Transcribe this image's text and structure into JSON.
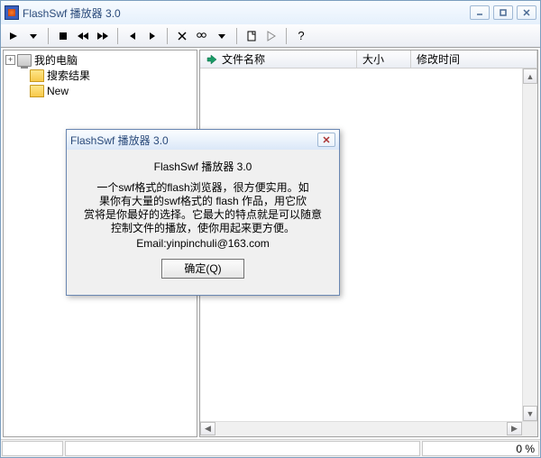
{
  "window": {
    "title": "FlashSwf 播放器 3.0"
  },
  "toolbar_icons": {
    "play": "play",
    "stop": "stop",
    "rew": "rewind",
    "ff": "fast-forward",
    "sep": "",
    "prev": "prev-frame",
    "next": "next-frame",
    "scissors": "cut",
    "binoc": "find",
    "new": "new-doc",
    "arrow": "run",
    "help": "?"
  },
  "tree": {
    "items": [
      {
        "label": "我的电脑",
        "icon": "computer",
        "depth": 0,
        "toggle": "+"
      },
      {
        "label": "搜索结果",
        "icon": "folder",
        "depth": 1,
        "toggle": ""
      },
      {
        "label": "New",
        "icon": "folder",
        "depth": 1,
        "toggle": ""
      }
    ]
  },
  "list": {
    "columns": {
      "name": "文件名称",
      "size": "大小",
      "date": "修改时间"
    }
  },
  "status": {
    "percent": "0 %"
  },
  "about": {
    "title": "FlashSwf 播放器 3.0",
    "heading": "FlashSwf 播放器 3.0",
    "body_lines": [
      "一个swf格式的flash浏览器，很方便实用。如",
      "果你有大量的swf格式的    flash 作品，用它欣",
      "赏将是你最好的选择。它最大的特点就是可以随意",
      "控制文件的播放，使你用起来更方便。"
    ],
    "email": "Email:yinpinchuli@163.com",
    "ok": "确定(Q)"
  }
}
